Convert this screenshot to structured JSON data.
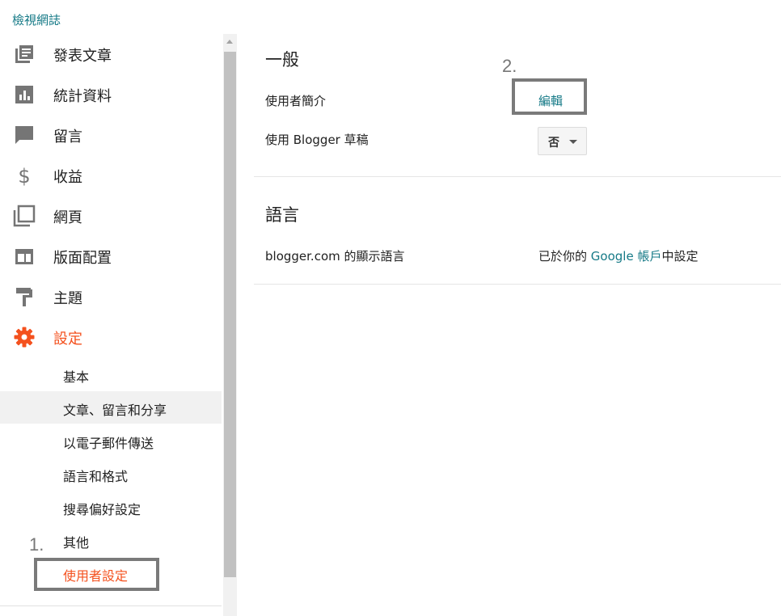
{
  "header": {
    "view_blog": "檢視網誌"
  },
  "sidebar": {
    "items": [
      {
        "label": "發表文章",
        "icon": "posts-icon"
      },
      {
        "label": "統計資料",
        "icon": "stats-icon"
      },
      {
        "label": "留言",
        "icon": "comments-icon"
      },
      {
        "label": "收益",
        "icon": "dollar-icon"
      },
      {
        "label": "網頁",
        "icon": "pages-icon"
      },
      {
        "label": "版面配置",
        "icon": "layout-icon"
      },
      {
        "label": "主題",
        "icon": "theme-icon"
      },
      {
        "label": "設定",
        "icon": "gear-icon",
        "active": true
      }
    ],
    "sub_items": [
      {
        "label": "基本"
      },
      {
        "label": "文章、留言和分享",
        "hover": true
      },
      {
        "label": "以電子郵件傳送"
      },
      {
        "label": "語言和格式"
      },
      {
        "label": "搜尋偏好設定"
      },
      {
        "label": "其他"
      },
      {
        "label": "使用者設定",
        "active": true
      }
    ]
  },
  "annotations": {
    "step1": "1.",
    "step2": "2."
  },
  "main": {
    "general": {
      "title": "一般",
      "profile_label": "使用者簡介",
      "edit_label": "編輯",
      "draft_label": "使用 Blogger 草稿",
      "draft_value": "否"
    },
    "language": {
      "title": "語言",
      "display_label": "blogger.com 的顯示語言",
      "value_prefix": "已於你的",
      "value_link": "Google 帳戶",
      "value_suffix": "中設定"
    }
  },
  "colors": {
    "accent": "#f4511e",
    "link": "#167a87",
    "icon": "#757575"
  }
}
